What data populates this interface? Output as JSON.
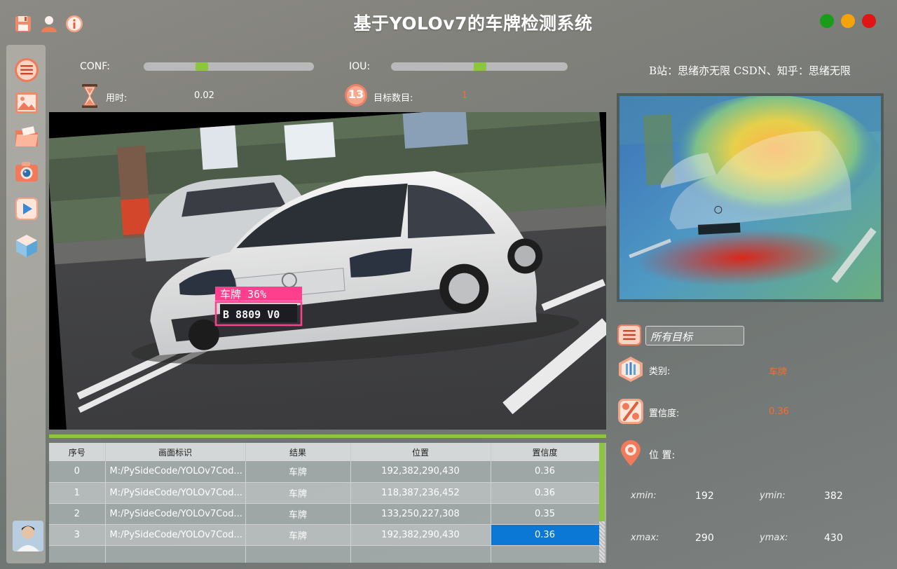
{
  "window": {
    "title": "基于YOLOv7的车牌检测系统",
    "controls": {
      "close_color": "#e01515",
      "minimize_color": "#f5a30a",
      "maximize_color": "#1a9b1a"
    }
  },
  "toolbar": {
    "icons": [
      "save-icon",
      "user-icon",
      "info-icon"
    ]
  },
  "sidebar": {
    "icons": [
      "menu-icon",
      "image-icon",
      "folder-icon",
      "camera-icon",
      "play-icon",
      "model-icon"
    ]
  },
  "sliders": {
    "conf": {
      "label": "CONF:",
      "value_fraction": 0.33
    },
    "iou": {
      "label": "IOU:",
      "value_fraction": 0.5
    }
  },
  "stats": {
    "time_label": "用时:",
    "time_value": "0.02",
    "count_label": "目标数目:",
    "count_value": "1",
    "count_badge": "13"
  },
  "detection": {
    "label": "车牌 36%",
    "plate_text": "B 8809 V0"
  },
  "credits": "B站：思绪亦无限  CSDN、知乎：思绪无限",
  "filter": {
    "placeholder": "所有目标"
  },
  "details": {
    "class_label": "类别:",
    "class_value": "车牌",
    "conf_label": "置信度:",
    "conf_value": "0.36",
    "pos_label": "位 置:",
    "xmin_label": "xmin:",
    "xmin_value": "192",
    "ymin_label": "ymin:",
    "ymin_value": "382",
    "xmax_label": "xmax:",
    "xmax_value": "290",
    "ymax_label": "ymax:",
    "ymax_value": "430"
  },
  "table": {
    "headers": [
      "序号",
      "画面标识",
      "结果",
      "位置",
      "置信度"
    ],
    "rows": [
      {
        "idx": "0",
        "path": "M:/PySideCode/YOLOv7Cod...",
        "result": "车牌",
        "pos": "192,382,290,430",
        "conf": "0.36"
      },
      {
        "idx": "1",
        "path": "M:/PySideCode/YOLOv7Cod...",
        "result": "车牌",
        "pos": "118,387,236,452",
        "conf": "0.36"
      },
      {
        "idx": "2",
        "path": "M:/PySideCode/YOLOv7Cod...",
        "result": "车牌",
        "pos": "133,250,227,308",
        "conf": "0.35"
      },
      {
        "idx": "3",
        "path": "M:/PySideCode/YOLOv7Cod...",
        "result": "车牌",
        "pos": "192,382,290,430",
        "conf": "0.36"
      }
    ]
  }
}
